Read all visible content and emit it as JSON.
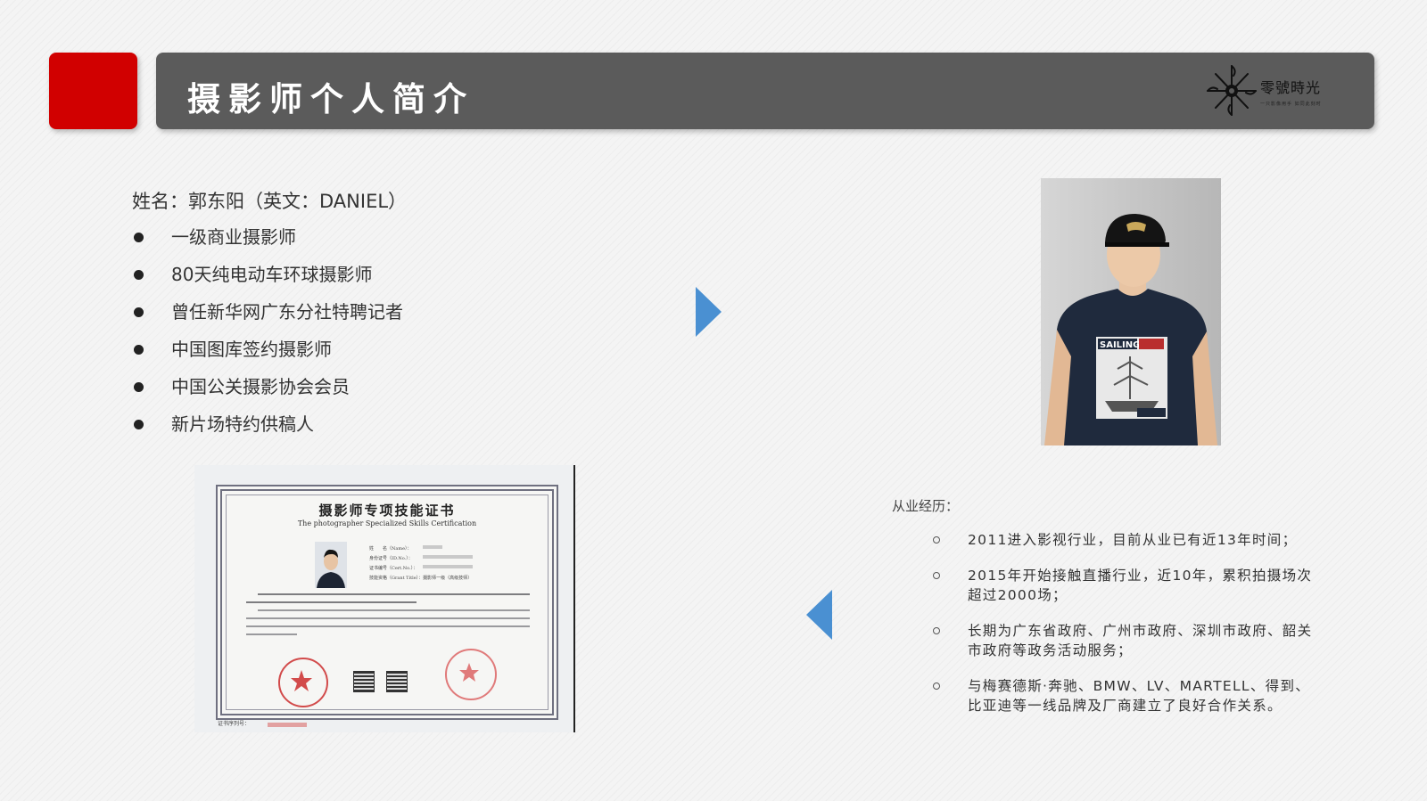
{
  "header": {
    "title": "摄影师个人简介",
    "logo": {
      "name": "零號時光",
      "tagline": "一只影像用手 如同此刻时",
      "icon": "sun-logo-icon"
    }
  },
  "profile": {
    "name_line": "姓名：郭东阳（英文：DANIEL）",
    "bullets": [
      "一级商业摄影师",
      "80天纯电动车环球摄影师",
      "曾任新华网广东分社特聘记者",
      "中国图库签约摄影师",
      "中国公关摄影协会会员",
      "新片场特约供稿人"
    ]
  },
  "certificate": {
    "title": "摄影师专项技能证书",
    "subtitle": "The photographer Specialized Skills Certification",
    "fields": [
      "姓　　名（Name）：",
      "身份证号（ID.No.）：",
      "证书编号（Cert.No.）：",
      "技能资格（Grant Title）：摄影师一级（高级技师）"
    ],
    "serial_label": "证书序列号："
  },
  "experience": {
    "label": "从业经历：",
    "items": [
      "2011进入影视行业，目前从业已有近13年时间；",
      "2015年开始接触直播行业，近10年，累积拍摄场次超过2000场；",
      "长期为广东省政府、广州市政府、深圳市政府、韶关市政府等政务活动服务；",
      "与梅赛德斯·奔驰、BMW、LV、MARTELL、得到、比亚迪等一线品牌及厂商建立了良好合作关系。"
    ]
  },
  "colors": {
    "accent_red": "#d10000",
    "header_gray": "#5b5b5b",
    "arrow_blue": "#4a90d2"
  }
}
